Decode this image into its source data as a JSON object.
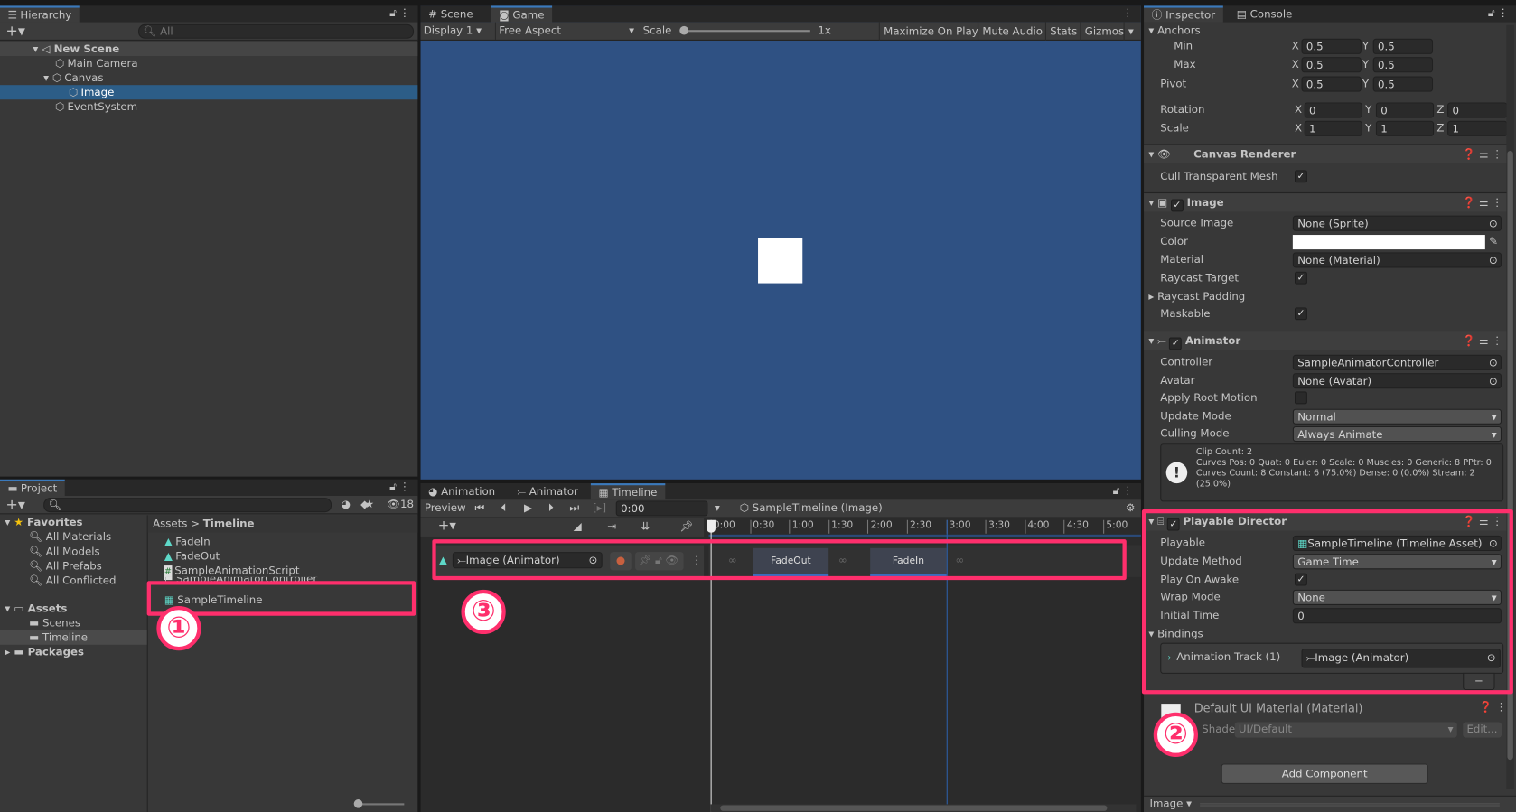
{
  "hierarchy": {
    "tab": "Hierarchy",
    "search_placeholder": "All",
    "scene": "New Scene",
    "items": [
      "Main Camera",
      "Canvas",
      "Image",
      "EventSystem"
    ],
    "selected": "Image"
  },
  "project": {
    "tab": "Project",
    "hidden_count": "18",
    "favorites": "Favorites",
    "fav_items": [
      "All Materials",
      "All Models",
      "All Prefabs",
      "All Conflicted"
    ],
    "assets": "Assets",
    "asset_folders": [
      "Scenes",
      "Timeline"
    ],
    "packages": "Packages",
    "breadcrumb": [
      "Assets",
      "Timeline"
    ],
    "files": [
      "FadeIn",
      "FadeOut",
      "SampleAnimationScript",
      "SampleAnimatorController",
      "SampleTimeline"
    ]
  },
  "game": {
    "tabs": [
      "Scene",
      "Game"
    ],
    "display": "Display 1",
    "aspect": "Free Aspect",
    "scale_label": "Scale",
    "scale_value": "1x",
    "buttons": [
      "Maximize On Play",
      "Mute Audio",
      "Stats",
      "Gizmos"
    ],
    "bg_color": "#2f5183"
  },
  "timeline": {
    "tabs": [
      "Animation",
      "Animator",
      "Timeline"
    ],
    "preview": "Preview",
    "time": "0:00",
    "asset": "SampleTimeline (Image)",
    "ruler": [
      "0:00",
      "0:30",
      "1:00",
      "1:30",
      "2:00",
      "2:30",
      "3:00",
      "3:30",
      "4:00",
      "4:30",
      "5:00"
    ],
    "track": "Image (Animator)",
    "clips": [
      "FadeOut",
      "FadeIn"
    ]
  },
  "inspector": {
    "tabs": [
      "Inspector",
      "Console"
    ],
    "anchors": "Anchors",
    "min": {
      "label": "Min",
      "x": "0.5",
      "y": "0.5"
    },
    "max": {
      "label": "Max",
      "x": "0.5",
      "y": "0.5"
    },
    "pivot": {
      "label": "Pivot",
      "x": "0.5",
      "y": "0.5"
    },
    "rotation": {
      "label": "Rotation",
      "x": "0",
      "y": "0",
      "z": "0"
    },
    "scale": {
      "label": "Scale",
      "x": "1",
      "y": "1",
      "z": "1"
    },
    "canvas_renderer": {
      "title": "Canvas Renderer",
      "cull": "Cull Transparent Mesh"
    },
    "image": {
      "title": "Image",
      "source_label": "Source Image",
      "source": "None (Sprite)",
      "color_label": "Color",
      "material_label": "Material",
      "material": "None (Material)",
      "raycast_target": "Raycast Target",
      "raycast_padding": "Raycast Padding",
      "maskable": "Maskable"
    },
    "animator": {
      "title": "Animator",
      "controller_label": "Controller",
      "controller": "SampleAnimatorController",
      "avatar_label": "Avatar",
      "avatar": "None (Avatar)",
      "root_motion": "Apply Root Motion",
      "update_label": "Update Mode",
      "update": "Normal",
      "culling_label": "Culling Mode",
      "culling": "Always Animate",
      "info": [
        "Clip Count: 2",
        "Curves Pos: 0 Quat: 0 Euler: 0 Scale: 0 Muscles: 0 Generic: 8 PPtr: 0",
        "Curves Count: 8 Constant: 6 (75.0%) Dense: 0 (0.0%) Stream: 2",
        "(25.0%)"
      ]
    },
    "director": {
      "title": "Playable Director",
      "playable_label": "Playable",
      "playable": "SampleTimeline (Timeline Asset)",
      "update_label": "Update Method",
      "update": "Game Time",
      "awake_label": "Play On Awake",
      "wrap_label": "Wrap Mode",
      "wrap": "None",
      "initial_label": "Initial Time",
      "initial": "0",
      "bindings": "Bindings",
      "binding_track": "Animation Track (1)",
      "binding_value": "Image (Animator)",
      "minus": "−"
    },
    "material": {
      "title": "Default UI Material (Material)",
      "shader_label": "Shader",
      "shader": "UI/Default",
      "edit": "Edit..."
    },
    "add_component": "Add Component",
    "footer": "Image"
  },
  "annotations": [
    "①",
    "②",
    "③"
  ],
  "accent": "#fe2f6c"
}
